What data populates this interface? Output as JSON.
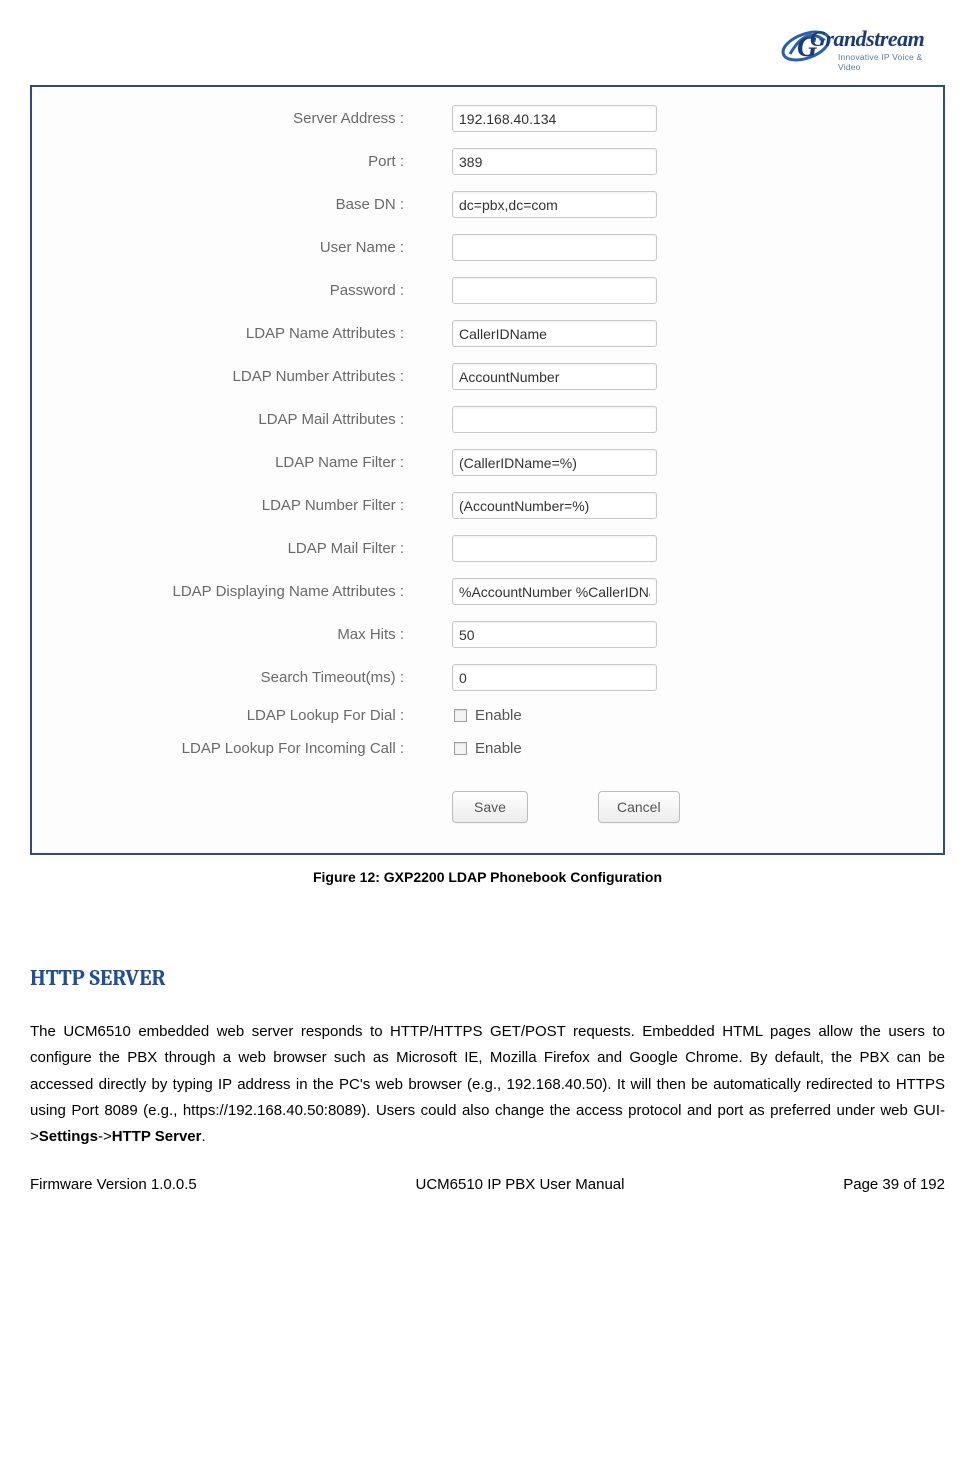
{
  "logo": {
    "brand": "Grandstream",
    "tagline": "Innovative IP Voice & Video"
  },
  "form": {
    "rows": [
      {
        "label": "Server Address :",
        "value": "192.168.40.134",
        "type": "text"
      },
      {
        "label": "Port :",
        "value": "389",
        "type": "text"
      },
      {
        "label": "Base DN :",
        "value": "dc=pbx,dc=com",
        "type": "text"
      },
      {
        "label": "User Name :",
        "value": "",
        "type": "text"
      },
      {
        "label": "Password :",
        "value": "",
        "type": "text"
      },
      {
        "label": "LDAP Name Attributes :",
        "value": "CallerIDName",
        "type": "text"
      },
      {
        "label": "LDAP Number Attributes :",
        "value": "AccountNumber",
        "type": "text"
      },
      {
        "label": "LDAP Mail Attributes :",
        "value": "",
        "type": "text"
      },
      {
        "label": "LDAP Name Filter :",
        "value": "(CallerIDName=%)",
        "type": "text"
      },
      {
        "label": "LDAP Number Filter :",
        "value": "(AccountNumber=%)",
        "type": "text"
      },
      {
        "label": "LDAP Mail Filter :",
        "value": "",
        "type": "text"
      },
      {
        "label": "LDAP Displaying Name Attributes :",
        "value": "%AccountNumber %CallerIDName",
        "type": "text"
      },
      {
        "label": "Max Hits :",
        "value": "50",
        "type": "text"
      },
      {
        "label": "Search Timeout(ms) :",
        "value": "0",
        "type": "text"
      },
      {
        "label": "LDAP Lookup For Dial :",
        "value": "Enable",
        "type": "checkbox",
        "checked": false
      },
      {
        "label": "LDAP Lookup For Incoming Call :",
        "value": "Enable",
        "type": "checkbox",
        "checked": false
      }
    ],
    "buttons": {
      "save": "Save",
      "cancel": "Cancel"
    }
  },
  "caption": "Figure 12: GXP2200 LDAP Phonebook Configuration",
  "heading": "HTTP SERVER",
  "paragraph": {
    "pre": "The UCM6510 embedded web server responds to HTTP/HTTPS GET/POST requests. Embedded HTML pages allow the users to configure the PBX through a web browser such as Microsoft IE, Mozilla Firefox and Google Chrome. By default, the PBX can be accessed directly by typing IP address in the PC's web browser (e.g., 192.168.40.50). It will then be automatically redirected to HTTPS using Port 8089 (e.g., https://192.168.40.50:8089). Users could also change the access protocol and port as preferred under web GUI->",
    "bold1": "Settings",
    "mid": "->",
    "bold2": "HTTP Server",
    "post": "."
  },
  "footer": {
    "left": "Firmware Version 1.0.0.5",
    "center": "UCM6510 IP PBX User Manual",
    "right": "Page 39 of 192"
  }
}
